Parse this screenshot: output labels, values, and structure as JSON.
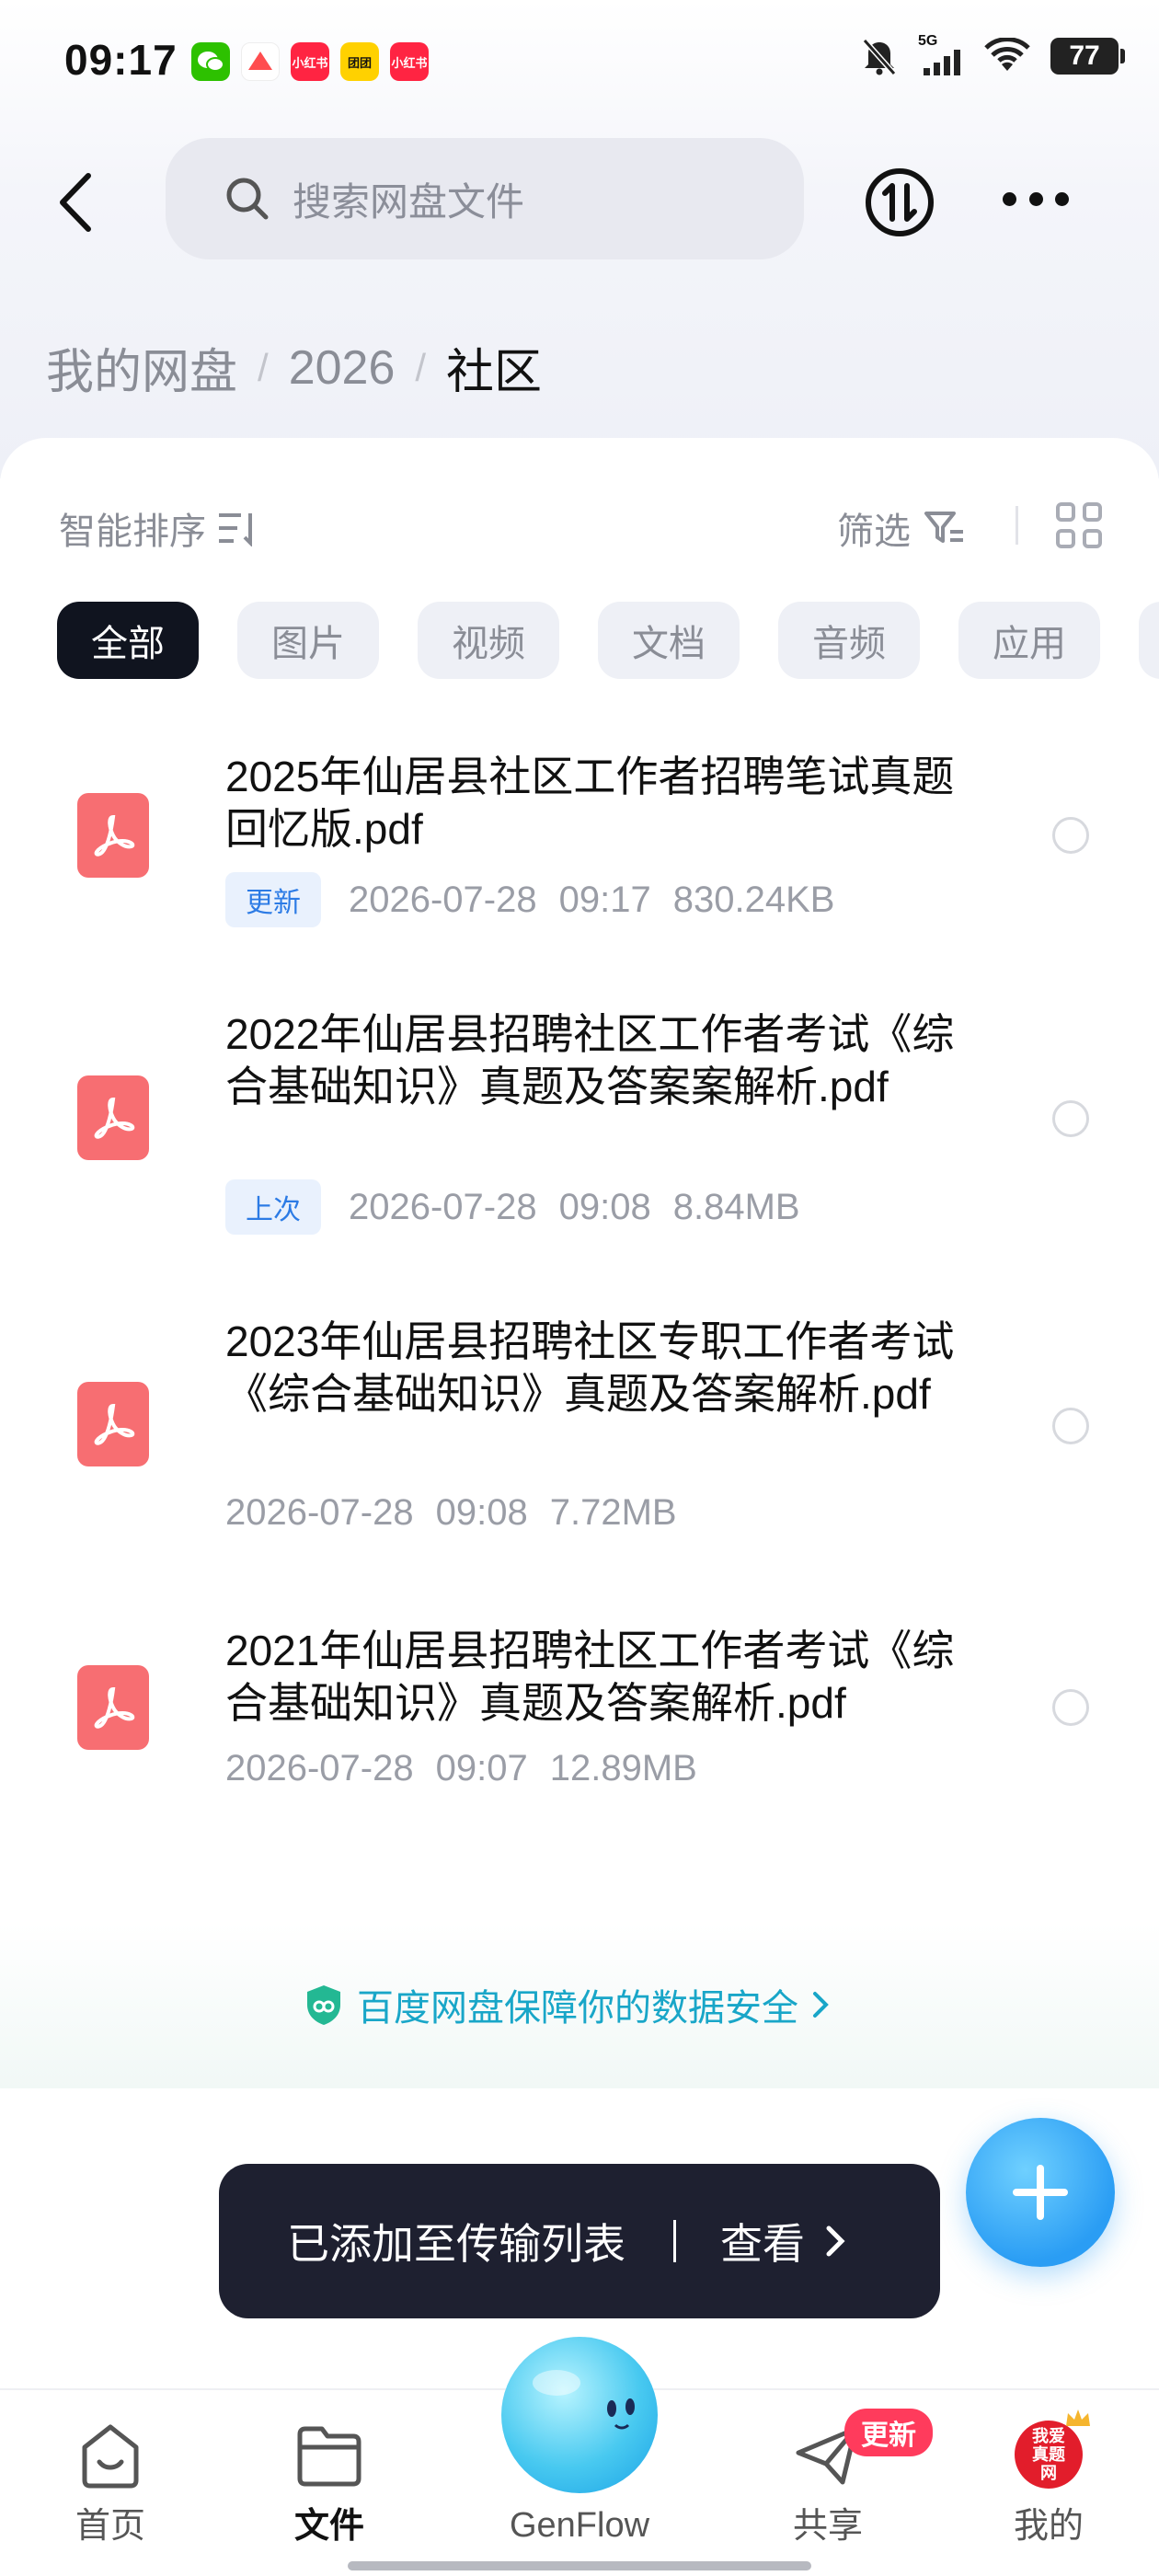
{
  "status_bar": {
    "time": "09:17",
    "network": "5G",
    "battery": "77",
    "notifications": [
      {
        "name": "wechat-icon",
        "label": "",
        "color": "#2dc100"
      },
      {
        "name": "app-icon",
        "label": "",
        "color": "#ff4d4f"
      },
      {
        "name": "xiaohongshu-icon",
        "label": "小红书",
        "color": "#ff2442"
      },
      {
        "name": "app-yellow-icon",
        "label": "团团",
        "color": "#ffd100"
      },
      {
        "name": "xiaohongshu-icon-2",
        "label": "小红书",
        "color": "#ff2442"
      }
    ]
  },
  "search": {
    "placeholder": "搜索网盘文件"
  },
  "breadcrumb": {
    "root": "我的网盘",
    "parent": "2026",
    "current": "社区",
    "separator": "/"
  },
  "toolbar": {
    "sort_label": "智能排序",
    "filter_label": "筛选"
  },
  "chips": [
    {
      "label": "全部",
      "active": true
    },
    {
      "label": "图片",
      "active": false
    },
    {
      "label": "视频",
      "active": false
    },
    {
      "label": "文档",
      "active": false
    },
    {
      "label": "音频",
      "active": false
    },
    {
      "label": "应用",
      "active": false
    }
  ],
  "files": [
    {
      "name": "2025年仙居县社区工作者招聘笔试真题回忆版.pdf",
      "badge": "更新",
      "date": "2026-07-28",
      "time": "09:17",
      "size": "830.24KB"
    },
    {
      "name": "2022年仙居县招聘社区工作者考试《综合基础知识》真题及答案案解析.pdf",
      "badge": "上次",
      "date": "2026-07-28",
      "time": "09:08",
      "size": "8.84MB"
    },
    {
      "name": "2023年仙居县招聘社区专职工作者考试《综合基础知识》真题及答案解析.pdf",
      "badge": "",
      "date": "2026-07-28",
      "time": "09:08",
      "size": "7.72MB"
    },
    {
      "name": "2021年仙居县招聘社区工作者考试《综合基础知识》真题及答案解析.pdf",
      "badge": "",
      "date": "2026-07-28",
      "time": "09:07",
      "size": "12.89MB"
    }
  ],
  "security_notice": "百度网盘保障你的数据安全",
  "toast": {
    "message": "已添加至传输列表",
    "action": "查看"
  },
  "bottom_nav": {
    "home": "首页",
    "files": "文件",
    "genflow": "GenFlow",
    "share": "共享",
    "share_badge": "更新",
    "mine": "我的",
    "avatar_text": "我爱真题网"
  }
}
